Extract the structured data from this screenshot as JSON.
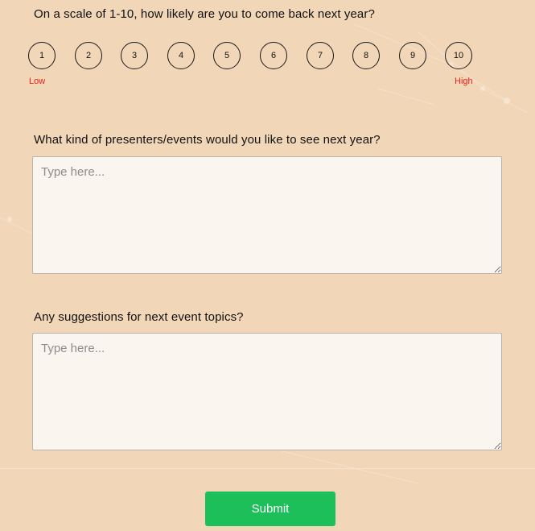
{
  "survey": {
    "scale_question": "On a scale of 1-10, how likely are you to come back next year?",
    "scale_options": [
      "1",
      "2",
      "3",
      "4",
      "5",
      "6",
      "7",
      "8",
      "9",
      "10"
    ],
    "low_label": "Low",
    "high_label": "High",
    "presenters_question": "What kind of presenters/events would you like to see next year?",
    "presenters_placeholder": "Type here...",
    "topics_question": "Any suggestions for next event topics?",
    "topics_placeholder": "Type here...",
    "submit_label": "Submit"
  },
  "colors": {
    "background": "#f1d6b8",
    "accent": "#1dbf5a",
    "scale_label": "#e8231b"
  }
}
